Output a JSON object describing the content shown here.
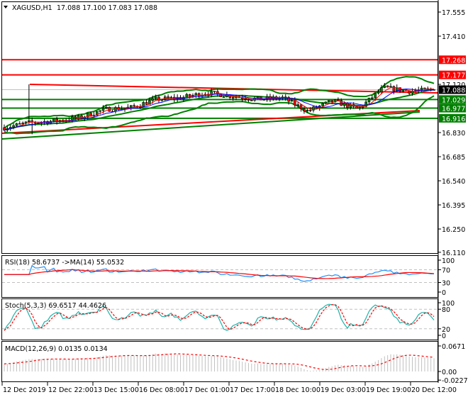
{
  "header": {
    "symbol": "XAGUSD,H1",
    "ohlc": "17.088 17.100 17.083 17.088"
  },
  "price_axis": {
    "ticks": [
      17.555,
      17.41,
      17.12,
      16.83,
      16.685,
      16.54,
      16.395,
      16.25,
      16.11
    ],
    "tick_labels": [
      "17.555",
      "17.410",
      "17.120",
      "16.830",
      "16.685",
      "16.540",
      "16.395",
      "16.250",
      "16.110"
    ]
  },
  "levels": [
    {
      "label": "17.268",
      "value": 17.268,
      "color": "#ff0000"
    },
    {
      "label": "17.177",
      "value": 17.177,
      "color": "#ff0000"
    },
    {
      "label": "17.088",
      "value": 17.088,
      "color": "#000000"
    },
    {
      "label": "17.029",
      "value": 17.029,
      "color": "#008000"
    },
    {
      "label": "16.977",
      "value": 16.977,
      "color": "#008000"
    },
    {
      "label": "16.916",
      "value": 16.916,
      "color": "#008000"
    }
  ],
  "price_path": [
    16.86,
    16.89,
    16.9,
    16.92,
    16.97,
    16.98,
    17.03,
    17.04,
    17.07,
    17.05,
    17.03,
    17.04,
    16.96,
    17.02,
    16.97,
    17.1,
    17.08,
    17.088
  ],
  "bars": 140,
  "rsi": {
    "title": "RSI(18) 58.6737  ->MA(14) 55.0532",
    "tick_labels": [
      "100",
      "70",
      "30",
      "0"
    ]
  },
  "stoch": {
    "title": "Stoch(5,3,3) 69.6517 44.4626",
    "tick_labels": [
      "100",
      "80",
      "20",
      "0"
    ]
  },
  "macd": {
    "title": "MACD(12,26,9) 0.0135 0.0134",
    "tick_labels": [
      "0.0671",
      "0.00",
      "-0.0227"
    ]
  },
  "time_axis": [
    "12 Dec 2019",
    "12 Dec 22:00",
    "13 Dec 15:00",
    "16 Dec 08:00",
    "17 Dec 01:00",
    "17 Dec 17:00",
    "18 Dec 10:00",
    "19 Dec 03:00",
    "19 Dec 19:00",
    "20 Dec 12:00"
  ],
  "colors": {
    "bull": "#008000",
    "bear": "#ff0000",
    "band": "#008000",
    "ma_fast": "#ff0000",
    "ma_slow": "#0000ff",
    "rsi": "#1e90ff",
    "stoch_main": "#20b2aa",
    "signal": "#ff0000",
    "hist": "#c0c0c0"
  }
}
